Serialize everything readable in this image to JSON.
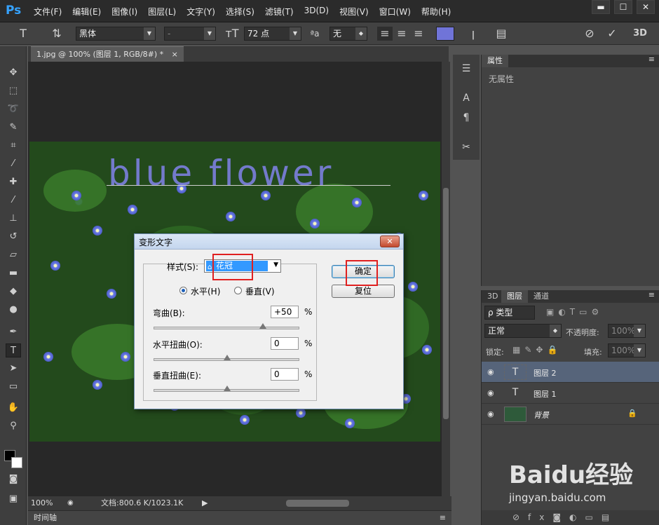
{
  "app": {
    "logo": "Ps"
  },
  "menu": [
    "文件(F)",
    "编辑(E)",
    "图像(I)",
    "图层(L)",
    "文字(Y)",
    "选择(S)",
    "滤镜(T)",
    "3D(D)",
    "视图(V)",
    "窗口(W)",
    "帮助(H)"
  ],
  "window_controls": [
    "▬",
    "☐",
    "✕"
  ],
  "options": {
    "font_family": "黑体",
    "font_style": "-",
    "font_size": "72 点",
    "aa_label": "ªa",
    "antialias": "无",
    "mode_3d": "3D",
    "text_color": "#7074d8"
  },
  "document": {
    "tab_title": "1.jpg @ 100% (图层 1, RGB/8#) *",
    "canvas_text": "blue flower",
    "zoom": "100%",
    "doc_info": "文档:800.6 K/1023.1K"
  },
  "timeline_label": "时间轴",
  "properties": {
    "tab": "属性",
    "content": "无属性"
  },
  "layers_panel": {
    "tabs": [
      "3D",
      "图层",
      "通道"
    ],
    "filter": "ρ 类型",
    "blend_mode": "正常",
    "opacity_label": "不透明度:",
    "opacity_value": "100%",
    "lock_label": "锁定:",
    "fill_label": "填充:",
    "fill_value": "100%",
    "layers": [
      {
        "name": "图层 2",
        "type": "text",
        "selected": true
      },
      {
        "name": "图层 1",
        "type": "text",
        "selected": false
      },
      {
        "name": "背景",
        "type": "image",
        "selected": false,
        "locked": true
      }
    ]
  },
  "dialog": {
    "title": "变形文字",
    "style_label": "样式(S):",
    "style_value": "花冠",
    "horizontal_label": "水平(H)",
    "vertical_label": "垂直(V)",
    "orientation": "horizontal",
    "bend_label": "弯曲(B):",
    "bend_value": "+50",
    "h_distort_label": "水平扭曲(O):",
    "h_distort_value": "0",
    "v_distort_label": "垂直扭曲(E):",
    "v_distort_value": "0",
    "percent": "%",
    "ok_label": "确定",
    "reset_label": "复位"
  },
  "watermark": {
    "logo": "Baidu经验",
    "url": "jingyan.baidu.com"
  }
}
